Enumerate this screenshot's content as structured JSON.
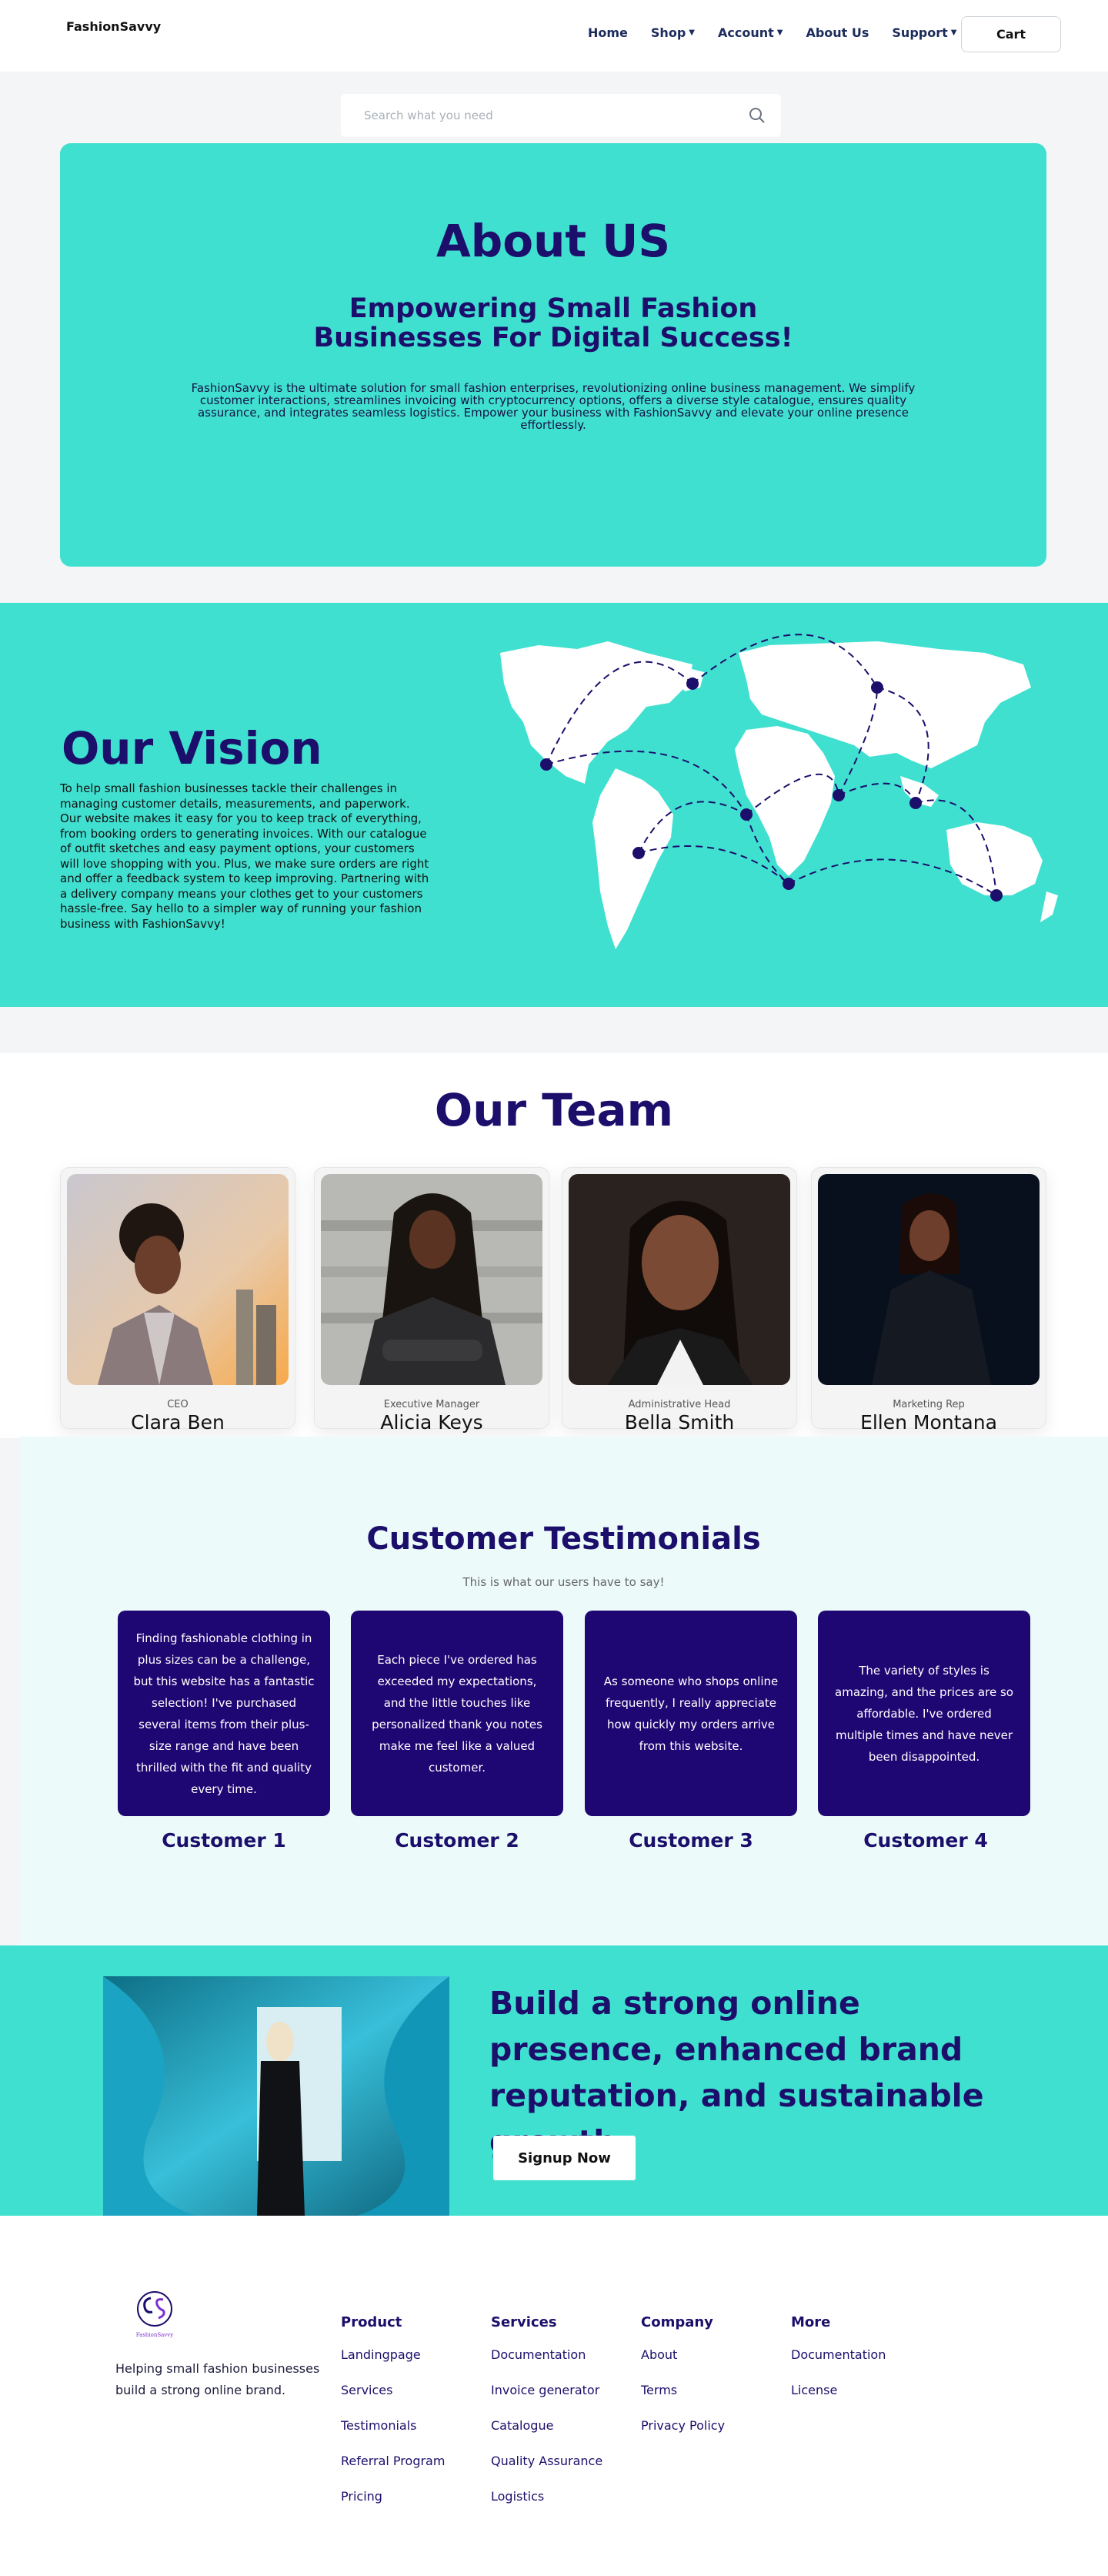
{
  "header": {
    "logo": "FashionSavvy",
    "nav": [
      {
        "label": "Home",
        "dropdown": false
      },
      {
        "label": "Shop",
        "dropdown": true
      },
      {
        "label": "Account",
        "dropdown": true
      },
      {
        "label": "About Us",
        "dropdown": false
      },
      {
        "label": "Support",
        "dropdown": true
      }
    ],
    "cart_label": "Cart"
  },
  "search": {
    "placeholder": "Search what you need",
    "icon": "search-icon"
  },
  "about": {
    "title": "About US",
    "subtitle": "Empowering Small Fashion Businesses For Digital Success!",
    "body": "FashionSavvy is the ultimate solution for small fashion enterprises, revolutionizing online business management. We simplify customer interactions, streamlines invoicing with cryptocurrency options, offers a diverse style catalogue, ensures quality assurance, and integrates seamless logistics. Empower your business with FashionSavvy and elevate your online presence effortlessly."
  },
  "vision": {
    "title": "Our Vision",
    "body": "To help small fashion businesses tackle their challenges in managing customer details, measurements, and paperwork. Our website makes it easy for you to keep track of everything, from booking orders to generating invoices. With our catalogue of outfit sketches and easy payment options, your customers will love shopping with you. Plus, we make sure orders are right and offer a feedback system to keep improving. Partnering with a delivery company means your clothes get to your customers hassle-free. Say hello to a simpler way of running your fashion business with FashionSavvy!"
  },
  "team": {
    "title": "Our Team",
    "members": [
      {
        "role": "CEO",
        "name": "Clara Ben"
      },
      {
        "role": "Executive Manager",
        "name": "Alicia Keys"
      },
      {
        "role": "Administrative Head",
        "name": "Bella Smith"
      },
      {
        "role": "Marketing Rep",
        "name": "Ellen Montana"
      }
    ]
  },
  "testimonials": {
    "title": "Customer Testimonials",
    "subtitle": "This is what our users have to say!",
    "items": [
      {
        "text": "Finding fashionable clothing in plus sizes can be a challenge, but this website has a fantastic selection! I've purchased several items from their plus-size range and have been thrilled with the fit and quality every time.",
        "name": "Customer 1"
      },
      {
        "text": "Each piece I've ordered has exceeded my expectations, and the little touches like personalized thank you notes make me feel like a valued customer.",
        "name": "Customer 2"
      },
      {
        "text": "As someone who shops online frequently, I really appreciate how quickly my orders arrive from this website.",
        "name": "Customer 3"
      },
      {
        "text": "The variety of styles is amazing, and the prices are so affordable. I've ordered multiple times and have never been disappointed.",
        "name": "Customer 4"
      }
    ]
  },
  "cta": {
    "heading": "Build a strong online presence, enhanced brand reputation, and sustainable growth",
    "button": "Signup Now"
  },
  "footer": {
    "logo_text": "FashionSavvy",
    "tagline": "Helping small fashion businesses build a strong online brand.",
    "columns": [
      {
        "heading": "Product",
        "links": [
          "Landingpage",
          "Services",
          "Testimonials",
          "Referral Program",
          "Pricing"
        ]
      },
      {
        "heading": "Services",
        "links": [
          "Documentation",
          "Invoice generator",
          "Catalogue",
          "Quality Assurance",
          "Logistics"
        ]
      },
      {
        "heading": "Company",
        "links": [
          "About",
          "Terms",
          "Privacy Policy"
        ]
      },
      {
        "heading": "More",
        "links": [
          "Documentation",
          "License"
        ]
      }
    ]
  },
  "colors": {
    "accent": "#40e0d0",
    "brand": "#1b0f6b",
    "card": "#1f0773"
  }
}
